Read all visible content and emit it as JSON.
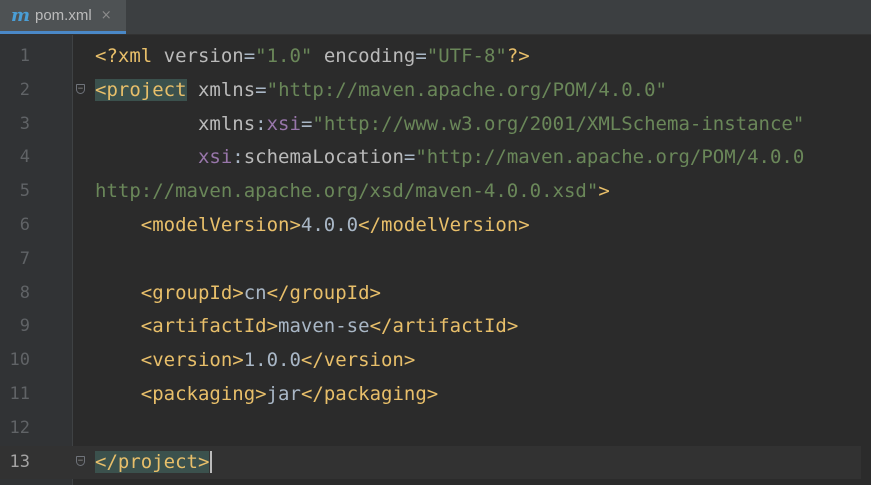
{
  "tab": {
    "icon": "m",
    "title": "pom.xml",
    "close_icon": "×"
  },
  "lines": [
    {
      "number": "1",
      "text": "<?xml version=\"1.0\" encoding=\"UTF-8\"?>"
    },
    {
      "number": "2",
      "text": "<project xmlns=\"http://maven.apache.org/POM/4.0.0\""
    },
    {
      "number": "3",
      "text": "         xmlns:xsi=\"http://www.w3.org/2001/XMLSchema-instance\""
    },
    {
      "number": "4",
      "text": "         xsi:schemaLocation=\"http://maven.apache.org/POM/4.0.0"
    },
    {
      "number": "5",
      "text": "http://maven.apache.org/xsd/maven-4.0.0.xsd\">"
    },
    {
      "number": "6",
      "text": "    <modelVersion>4.0.0</modelVersion>"
    },
    {
      "number": "7",
      "text": ""
    },
    {
      "number": "8",
      "text": "    <groupId>cn</groupId>"
    },
    {
      "number": "9",
      "text": "    <artifactId>maven-se</artifactId>"
    },
    {
      "number": "10",
      "text": "    <version>1.0.0</version>"
    },
    {
      "number": "11",
      "text": "    <packaging>jar</packaging>"
    },
    {
      "number": "12",
      "text": ""
    },
    {
      "number": "13",
      "text": "</project>"
    }
  ],
  "current_line": "13",
  "colors": {
    "background": "#2b2b2b",
    "tag": "#e8bf6a",
    "attribute": "#bababa",
    "value": "#6a8759",
    "namespace": "#9876aa",
    "text": "#a9b7c6",
    "brace_match": "#3b514d"
  },
  "icons": {
    "file_type": "maven-icon",
    "fold_start": "fold-open-icon",
    "fold_end": "fold-close-icon"
  }
}
